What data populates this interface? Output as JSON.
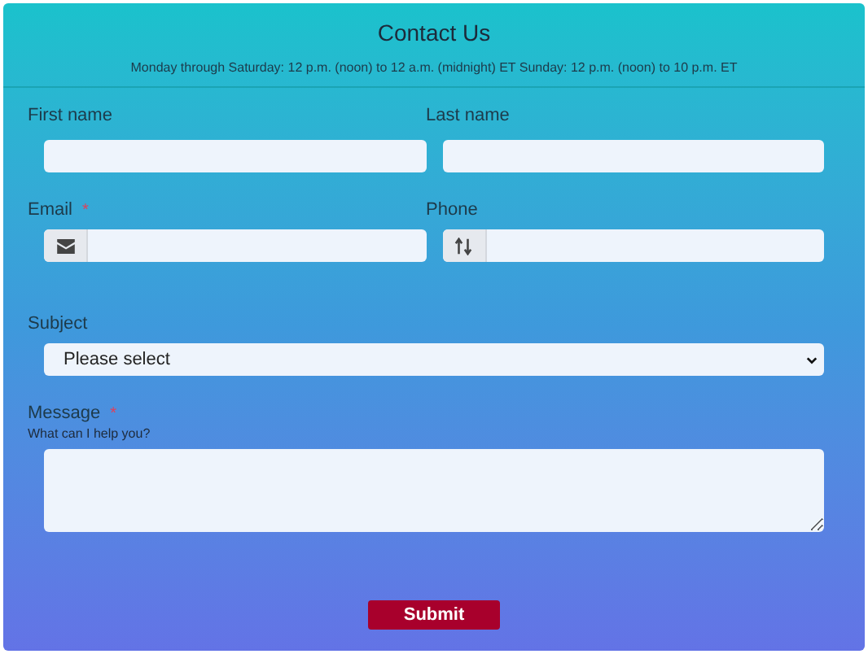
{
  "header": {
    "title": "Contact Us",
    "hours": "Monday through Saturday: 12 p.m. (noon) to 12 a.m. (midnight) ET Sunday: 12 p.m. (noon) to 10 p.m. ET"
  },
  "rows": [
    [
      {
        "kind": "text",
        "label": "First name"
      },
      {
        "kind": "text",
        "label": "Last name"
      }
    ],
    [
      {
        "kind": "email",
        "label": "Email",
        "required_mark": "*"
      },
      {
        "kind": "phone",
        "label": "Phone"
      }
    ],
    [
      {
        "kind": "select",
        "label": "Subject",
        "value": "Please select"
      }
    ],
    [
      {
        "kind": "textarea",
        "label": "Message",
        "required_mark": "*",
        "hint": "What can I help you?"
      }
    ]
  ],
  "submit": "Submit"
}
